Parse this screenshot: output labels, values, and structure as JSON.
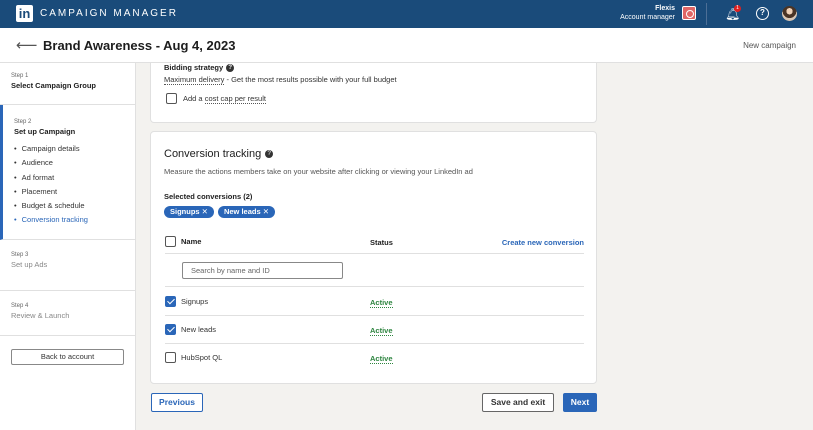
{
  "topbar": {
    "logo": "in",
    "app_title": "CAMPAIGN MANAGER",
    "account_name": "Flexis",
    "account_role": "Account manager",
    "notification_count": "1"
  },
  "header": {
    "title": "Brand Awareness - Aug 4, 2023",
    "new_campaign": "New campaign"
  },
  "sidebar": {
    "steps": [
      {
        "label": "Step 1",
        "title": "Select Campaign Group"
      },
      {
        "label": "Step 2",
        "title": "Set up Campaign",
        "items": [
          "Campaign details",
          "Audience",
          "Ad format",
          "Placement",
          "Budget & schedule",
          "Conversion tracking"
        ]
      },
      {
        "label": "Step 3",
        "title": "Set up Ads"
      },
      {
        "label": "Step 4",
        "title": "Review & Launch"
      }
    ],
    "back_button": "Back to account"
  },
  "bidding": {
    "title": "Bidding strategy",
    "desc_link": "Maximum delivery",
    "desc_rest": " - Get the most results possible with your full budget",
    "cap_prefix": "Add a ",
    "cap_link": "cost cap per result"
  },
  "conversion": {
    "title": "Conversion tracking",
    "description": "Measure the actions members take on your website after clicking or viewing your LinkedIn ad",
    "selected_title": "Selected conversions (2)",
    "pills": [
      "Signups ✕",
      "New leads ✕"
    ],
    "columns": {
      "name": "Name",
      "status": "Status",
      "create": "Create new conversion"
    },
    "search_placeholder": "Search by name and ID",
    "rows": [
      {
        "name": "Signups",
        "status": "Active",
        "checked": true
      },
      {
        "name": "New leads",
        "status": "Active",
        "checked": true
      },
      {
        "name": "HubSpot QL",
        "status": "Active",
        "checked": false
      }
    ]
  },
  "footer": {
    "previous": "Previous",
    "save_exit": "Save and exit",
    "next": "Next"
  }
}
